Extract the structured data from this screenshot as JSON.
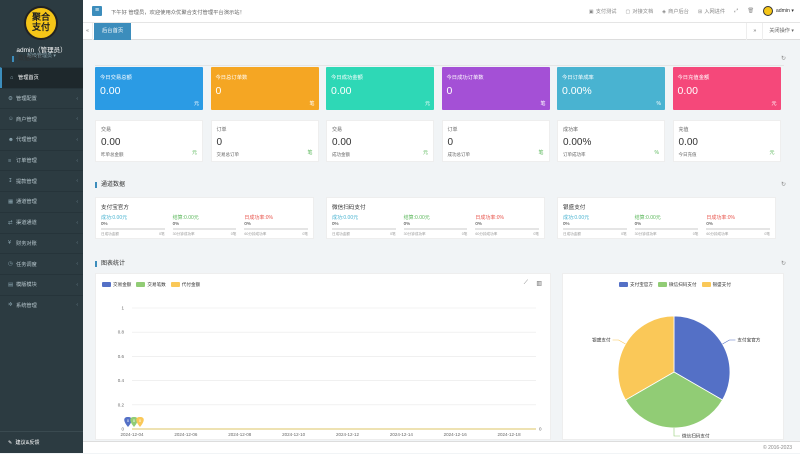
{
  "sidebar": {
    "logo_text_1": "聚合",
    "logo_text_2": "支付",
    "user": "admin（管理员）",
    "role": "超级管理员 ▾",
    "items": [
      {
        "label": "管理首页",
        "icon": "home-icon"
      },
      {
        "label": "管理配置",
        "icon": "gear-icon"
      },
      {
        "label": "商户管理",
        "icon": "users-icon"
      },
      {
        "label": "代理管理",
        "icon": "user-group-icon"
      },
      {
        "label": "订单管理",
        "icon": "list-icon"
      },
      {
        "label": "提款管理",
        "icon": "withdraw-icon"
      },
      {
        "label": "通道管理",
        "icon": "channel-icon"
      },
      {
        "label": "渠道通道",
        "icon": "route-icon"
      },
      {
        "label": "财务对账",
        "icon": "money-icon"
      },
      {
        "label": "任务调度",
        "icon": "clock-icon"
      },
      {
        "label": "模版模块",
        "icon": "template-icon"
      },
      {
        "label": "系统管理",
        "icon": "cog-icon"
      }
    ],
    "footer": "建议&反馈"
  },
  "topbar": {
    "welcome": "下午好 管理员，欢迎使用众优聚合支付管理平台演示站！",
    "links": [
      {
        "label": "支付测试",
        "icon": "pay-icon"
      },
      {
        "label": "对接文档",
        "icon": "doc-icon"
      },
      {
        "label": "商户后台",
        "icon": "shield-icon"
      },
      {
        "label": "入网进件",
        "icon": "plus-icon"
      }
    ],
    "user": "admin ▾"
  },
  "tabs": {
    "home": "后台首页",
    "close": "关闭操作 ▾"
  },
  "sections": {
    "stats": "数据统计",
    "channels": "通道数据",
    "charts": "图表统计"
  },
  "colors": {
    "primary": "#3c8dbc"
  },
  "cards": [
    {
      "title": "今日交易总额",
      "value": "0.00",
      "icon": "元",
      "color": "#2b9be4"
    },
    {
      "title": "今日总订单数",
      "value": "0",
      "icon": "笔",
      "color": "#f5a623"
    },
    {
      "title": "今日成功金额",
      "value": "0.00",
      "icon": "元",
      "color": "#2ed8b6"
    },
    {
      "title": "今日成功订单数",
      "value": "0",
      "icon": "笔",
      "color": "#a450d6"
    },
    {
      "title": "今日订单成率",
      "value": "0.00%",
      "icon": "%",
      "color": "#49b3d1"
    },
    {
      "title": "今日充值金额",
      "value": "0.00",
      "icon": "元",
      "color": "#f5487a"
    }
  ],
  "small_cards": [
    {
      "title": "交易",
      "value": "0.00",
      "desc": "昨单总金额",
      "icon": "元"
    },
    {
      "title": "订单",
      "value": "0",
      "desc": "交易总订单",
      "icon": "笔"
    },
    {
      "title": "交易",
      "value": "0.00",
      "desc": "成功金额",
      "icon": "元"
    },
    {
      "title": "订单",
      "value": "0",
      "desc": "成功总订单",
      "icon": "笔"
    },
    {
      "title": "成功率",
      "value": "0.00%",
      "desc": "订单成功率",
      "icon": "%"
    },
    {
      "title": "充值",
      "value": "0.00",
      "desc": "今日充值",
      "icon": "元"
    }
  ],
  "channels": [
    {
      "name": "支付宝官方",
      "success": "成功:0.00元",
      "succ_pct": "0%",
      "fail": "结算:0.00元",
      "fail_pct": "0%",
      "rate": "日成功率:0%",
      "rate_pct": "0%",
      "f1": "日成功金额",
      "f1v": "0笔",
      "f2": "30分钟成功率",
      "f2v": "0笔",
      "f3": "60分钟成功率",
      "f3v": "0笔"
    },
    {
      "name": "微信扫码支付",
      "success": "成功:0.00元",
      "succ_pct": "0%",
      "fail": "结算:0.00元",
      "fail_pct": "0%",
      "rate": "日成功率:0%",
      "rate_pct": "0%",
      "f1": "日成功金额",
      "f1v": "0笔",
      "f2": "30分钟成功率",
      "f2v": "0笔",
      "f3": "60分钟成功率",
      "f3v": "0笔"
    },
    {
      "name": "银盛支付",
      "success": "成功:0.00元",
      "succ_pct": "0%",
      "fail": "结算:0.00元",
      "fail_pct": "0%",
      "rate": "日成功率:0%",
      "rate_pct": "0%",
      "f1": "日成功金额",
      "f1v": "0笔",
      "f2": "30分钟成功率",
      "f2v": "0笔",
      "f3": "60分钟成功率",
      "f3v": "0笔"
    }
  ],
  "chart_data": [
    {
      "type": "line",
      "series": [
        {
          "name": "交易金额",
          "color": "#5470c6",
          "values": [
            0,
            0,
            0,
            0,
            0,
            0,
            0,
            0,
            0,
            0,
            0,
            0,
            0,
            0,
            0,
            0
          ]
        },
        {
          "name": "交易笔数",
          "color": "#91cc75",
          "values": [
            0,
            0,
            0,
            0,
            0,
            0,
            0,
            0,
            0,
            0,
            0,
            0,
            0,
            0,
            0,
            0
          ]
        },
        {
          "name": "代付金额",
          "color": "#fac858",
          "values": [
            0,
            0,
            0,
            0,
            0,
            0,
            0,
            0,
            0,
            0,
            0,
            0,
            0,
            0,
            0,
            0
          ]
        }
      ],
      "x": [
        "2024-12-04",
        "2024-12-05",
        "2024-12-06",
        "2024-12-07",
        "2024-12-08",
        "2024-12-09",
        "2024-12-10",
        "2024-12-11",
        "2024-12-12",
        "2024-12-13",
        "2024-12-14",
        "2024-12-15",
        "2024-12-16",
        "2024-12-17",
        "2024-12-18",
        "2024-12-19"
      ],
      "xticks": [
        "2024-12-04",
        "2024-12-06",
        "2024-12-08",
        "2024-12-10",
        "2024-12-12",
        "2024-12-14",
        "2024-12-16",
        "2024-12-18"
      ],
      "yticks": [
        "1",
        "0.8",
        "0.6",
        "0.4",
        "0.2",
        "0"
      ],
      "ylim": [
        0,
        1
      ],
      "markers": [
        "0",
        "0",
        "0"
      ],
      "end_label": "0"
    },
    {
      "type": "pie",
      "series": [
        {
          "name": "支付宝官方",
          "value": 1,
          "color": "#5470c6"
        },
        {
          "name": "微信扫码支付",
          "value": 1,
          "color": "#91cc75"
        },
        {
          "name": "银盛支付",
          "value": 1,
          "color": "#fac858"
        }
      ]
    }
  ],
  "footer": "© 2016-2023"
}
